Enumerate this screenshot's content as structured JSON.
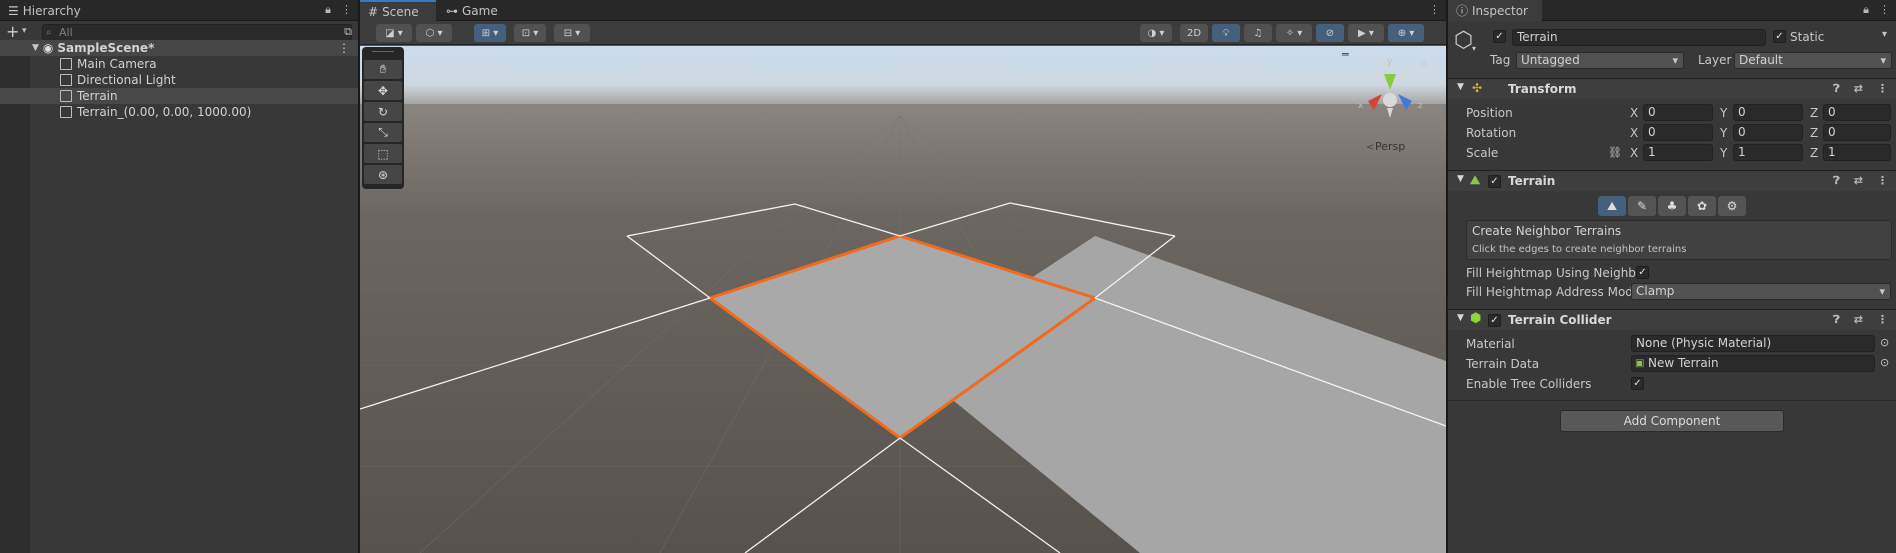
{
  "hierarchy": {
    "tab_label": "Hierarchy",
    "add_label": "+",
    "search_placeholder": "All",
    "scene_name": "SampleScene*",
    "items": [
      {
        "label": "Main Camera"
      },
      {
        "label": "Directional Light"
      },
      {
        "label": "Terrain"
      },
      {
        "label": "Terrain_(0.00, 0.00, 1000.00)"
      }
    ]
  },
  "scene": {
    "tabs": [
      {
        "label": "Scene",
        "icon": "grid-icon"
      },
      {
        "label": "Game",
        "icon": "gamepad-icon"
      }
    ],
    "toggle_2d_label": "2D",
    "persp_label": "Persp",
    "gizmo_axes": {
      "x": "x",
      "y": "y",
      "z": "z"
    }
  },
  "inspector": {
    "tab_label": "Inspector",
    "object_name": "Terrain",
    "static_label": "Static",
    "tag_label": "Tag",
    "tag_value": "Untagged",
    "layer_label": "Layer",
    "layer_value": "Default",
    "transform": {
      "title": "Transform",
      "position_label": "Position",
      "rotation_label": "Rotation",
      "scale_label": "Scale",
      "position": {
        "x": "0",
        "y": "0",
        "z": "0"
      },
      "rotation": {
        "x": "0",
        "y": "0",
        "z": "0"
      },
      "scale": {
        "x": "1",
        "y": "1",
        "z": "1"
      },
      "axis_x": "X",
      "axis_y": "Y",
      "axis_z": "Z"
    },
    "terrain": {
      "title": "Terrain",
      "neighbor_title": "Create Neighbor Terrains",
      "neighbor_hint": "Click the edges to create neighbor terrains",
      "fill_label": "Fill Heightmap Using Neighbo",
      "address_label": "Fill Heightmap Address Mode",
      "address_value": "Clamp"
    },
    "collider": {
      "title": "Terrain Collider",
      "material_label": "Material",
      "material_value": "None (Physic Material)",
      "data_label": "Terrain Data",
      "data_value": "New Terrain",
      "trees_label": "Enable Tree Colliders"
    },
    "add_component_label": "Add Component"
  },
  "colors": {
    "accent": "#3a79bb",
    "selection_outline": "#f26a1b",
    "terrain_fill": "#a9a9a9",
    "ground": "#5c5651"
  }
}
